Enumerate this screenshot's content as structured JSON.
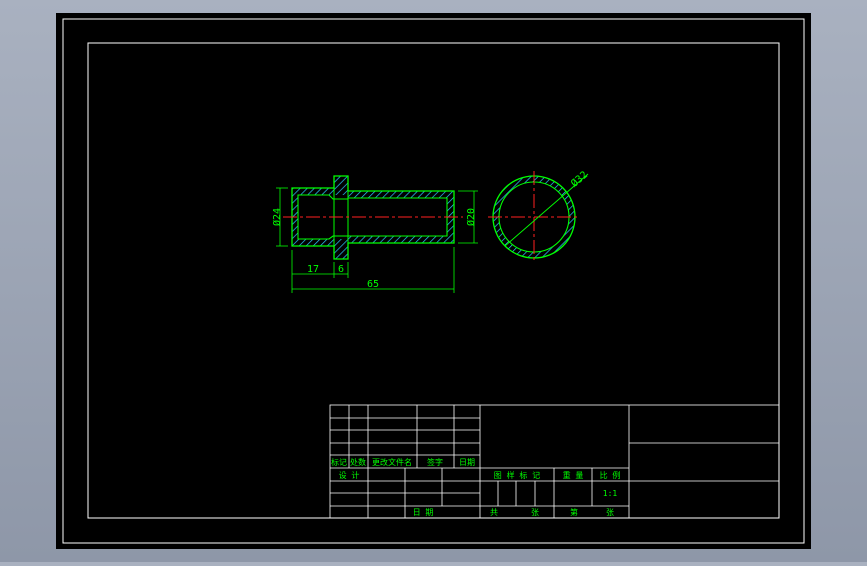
{
  "colors": {
    "background": "#000000",
    "frame": "#ffffff",
    "outline": "#00ff00",
    "hatch": "#2ec8ff",
    "centerline": "#ff2020",
    "dimension": "#00ff00",
    "title_text": "#00ff00",
    "window_bg": "#98a0b0"
  },
  "drawing": {
    "dims": {
      "d24": "Ø24",
      "d20": "Ø20",
      "d32": "Ø32",
      "len17": "17",
      "len6": "6",
      "len65": "65"
    }
  },
  "title_block": {
    "rev_headers": [
      "标记",
      "处数",
      "更改文件名",
      "签字",
      "日期"
    ],
    "design_label": "设 计",
    "date_label": "日 期",
    "stage_label": "图 样 标 记",
    "weight_label": "重 量",
    "scale_label": "比 例",
    "scale_value": "1:1",
    "total_label": "共",
    "sheets_label": "张",
    "sheet_label": "第",
    "sheet_unit": "张"
  }
}
